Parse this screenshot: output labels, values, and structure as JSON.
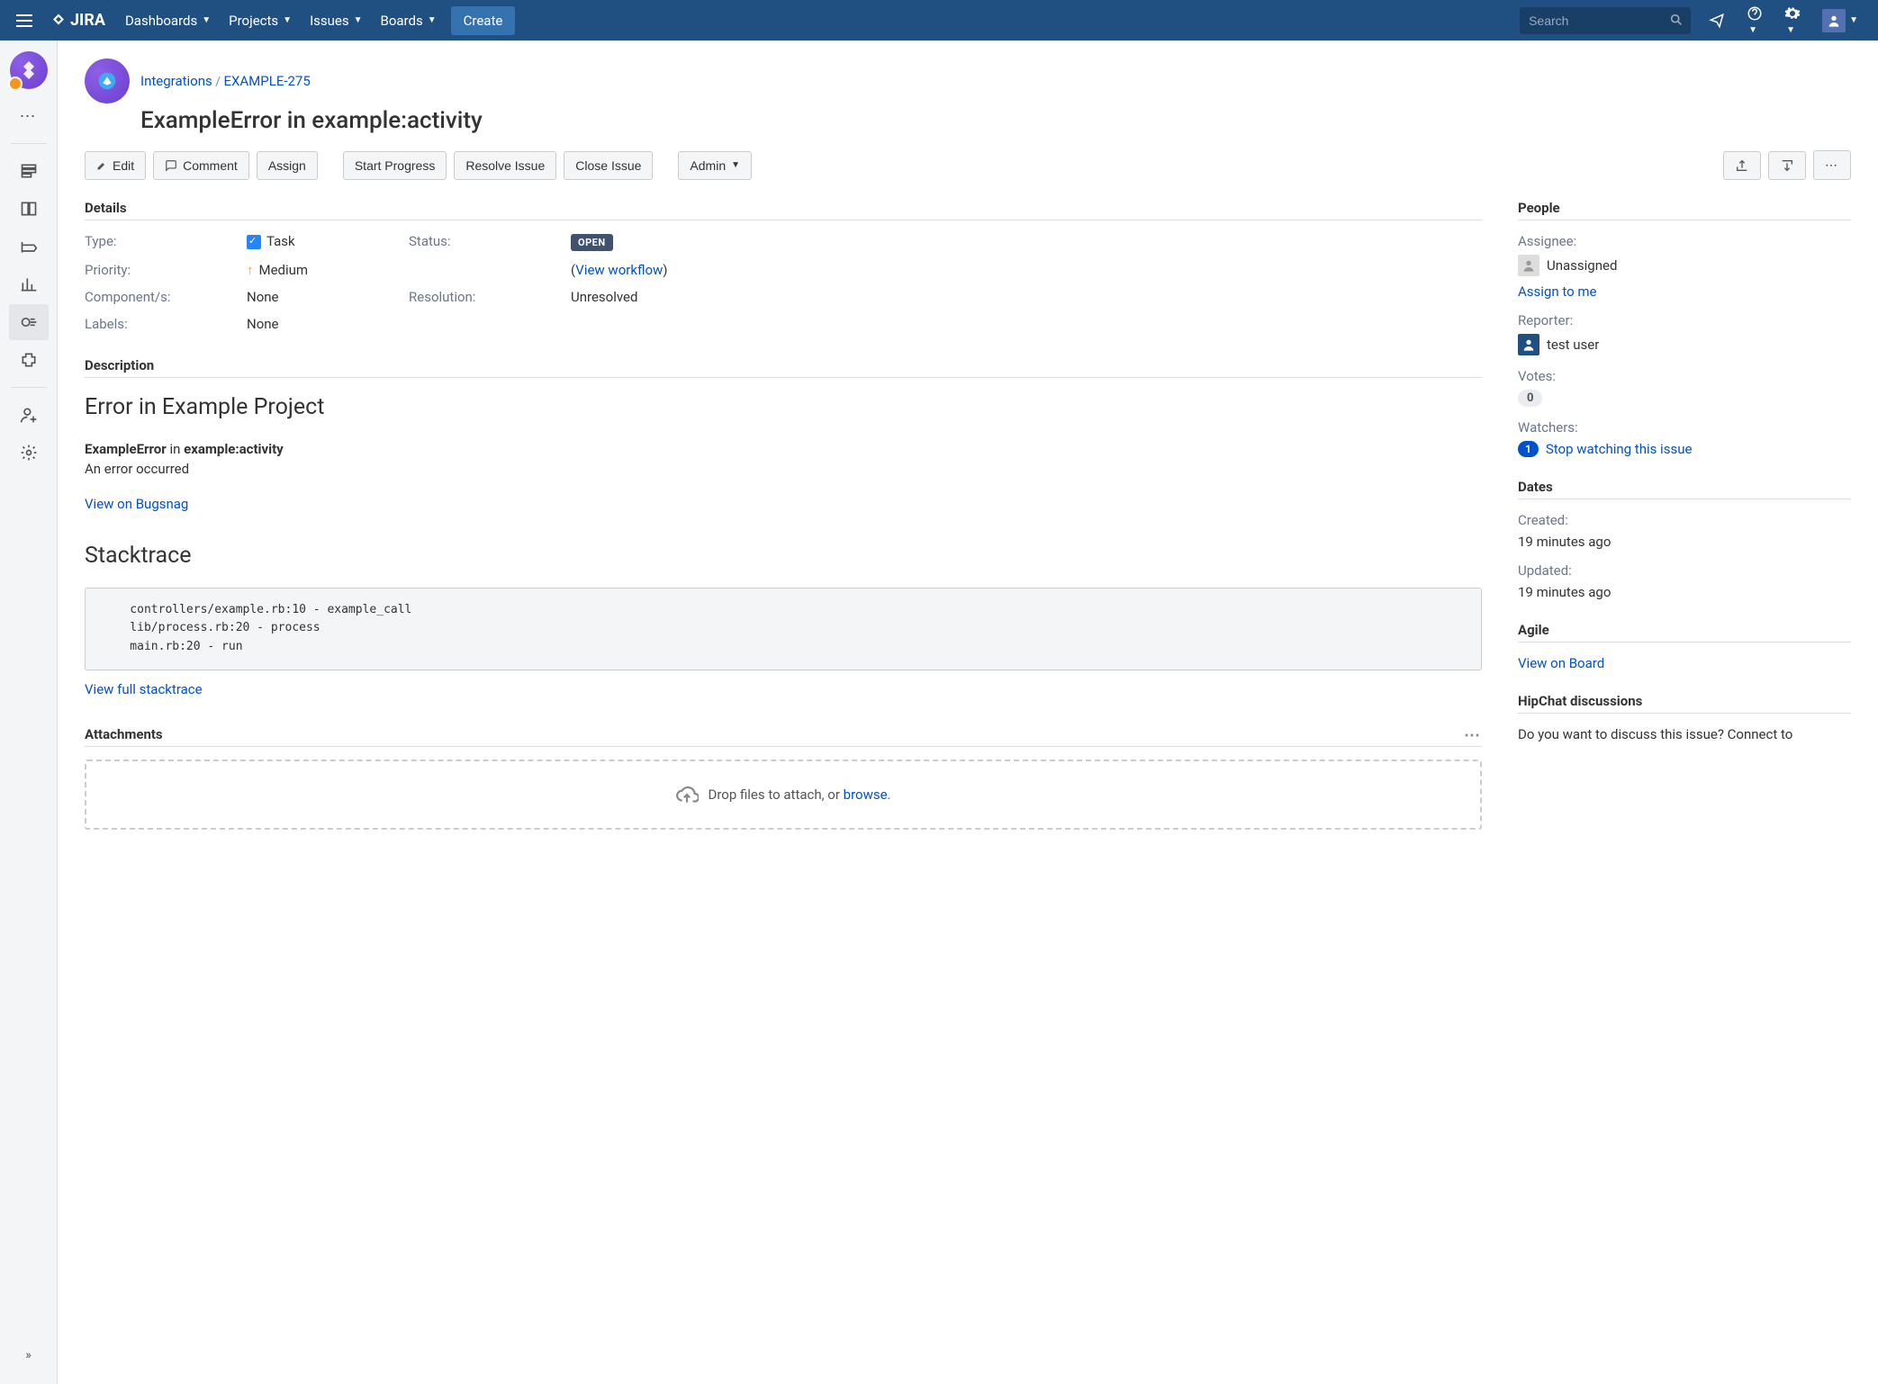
{
  "topbar": {
    "nav": {
      "dashboards": "Dashboards",
      "projects": "Projects",
      "issues": "Issues",
      "boards": "Boards"
    },
    "create": "Create",
    "search_placeholder": "Search"
  },
  "breadcrumb": {
    "project": "Integrations",
    "issue_key": "EXAMPLE-275"
  },
  "issue": {
    "title": "ExampleError in example:activity"
  },
  "toolbar": {
    "edit": "Edit",
    "comment": "Comment",
    "assign": "Assign",
    "start_progress": "Start Progress",
    "resolve": "Resolve Issue",
    "close": "Close Issue",
    "admin": "Admin"
  },
  "sections": {
    "details": "Details",
    "description": "Description",
    "attachments": "Attachments",
    "people": "People",
    "dates": "Dates",
    "agile": "Agile",
    "hipchat": "HipChat discussions"
  },
  "details": {
    "labels": {
      "type": "Type:",
      "priority": "Priority:",
      "components": "Component/s:",
      "labels_l": "Labels:",
      "status": "Status:",
      "resolution": "Resolution:"
    },
    "type": "Task",
    "priority": "Medium",
    "components": "None",
    "labels_v": "None",
    "status": "OPEN",
    "view_workflow": "View workflow",
    "resolution": "Unresolved"
  },
  "description": {
    "h1": "Error in Example Project",
    "err_name": "ExampleError",
    "err_in": " in ",
    "err_loc": "example:activity",
    "err_msg": "An error occurred",
    "view_bugsnag": "View on Bugsnag",
    "stack_h": "Stacktrace",
    "stack": "    controllers/example.rb:10 - example_call\n    lib/process.rb:20 - process\n    main.rb:20 - run",
    "view_full": "View full stacktrace"
  },
  "attachments": {
    "drop_text": "Drop files to attach, or ",
    "browse": "browse"
  },
  "people": {
    "assignee_l": "Assignee:",
    "assignee": "Unassigned",
    "assign_me": "Assign to me",
    "reporter_l": "Reporter:",
    "reporter": "test user",
    "votes_l": "Votes:",
    "votes": "0",
    "watchers_l": "Watchers:",
    "watchers_n": "1",
    "stop_watch": "Stop watching this issue"
  },
  "dates": {
    "created_l": "Created:",
    "created": "19 minutes ago",
    "updated_l": "Updated:",
    "updated": "19 minutes ago"
  },
  "agile": {
    "view_board": "View on Board"
  },
  "hipchat": {
    "text": "Do you want to discuss this issue? Connect to"
  }
}
